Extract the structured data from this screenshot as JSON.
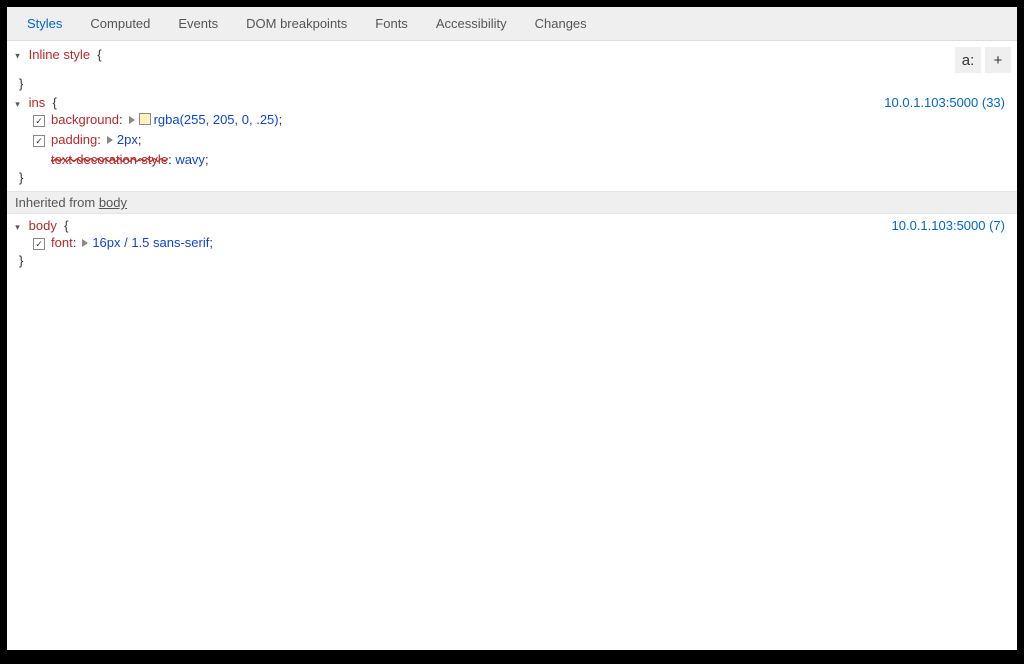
{
  "tabs": [
    "Styles",
    "Computed",
    "Events",
    "DOM breakpoints",
    "Fonts",
    "Accessibility",
    "Changes"
  ],
  "activeTab": "Styles",
  "toolbar": {
    "pseudo": "a:",
    "add": "+"
  },
  "rules": {
    "inline": {
      "selector": "Inline style",
      "open": "{",
      "close": "}"
    },
    "ins": {
      "selector": "ins",
      "open": "{",
      "close": "}",
      "source": "10.0.1.103:5000 (33)",
      "decls": {
        "background": {
          "prop": "background",
          "value": "rgba(255, 205, 0, .25)",
          "swatch": "rgba(255,205,0,0.25)"
        },
        "padding": {
          "prop": "padding",
          "value": "2px"
        },
        "tds": {
          "prop": "text-decoration-style",
          "value": "wavy"
        }
      }
    },
    "inheritBar": {
      "prefix": "Inherited from ",
      "el": "body"
    },
    "body": {
      "selector": "body",
      "open": "{",
      "close": "}",
      "source": "10.0.1.103:5000 (7)",
      "decls": {
        "font": {
          "prop": "font",
          "value": "16px / 1.5 sans-serif"
        }
      }
    }
  }
}
